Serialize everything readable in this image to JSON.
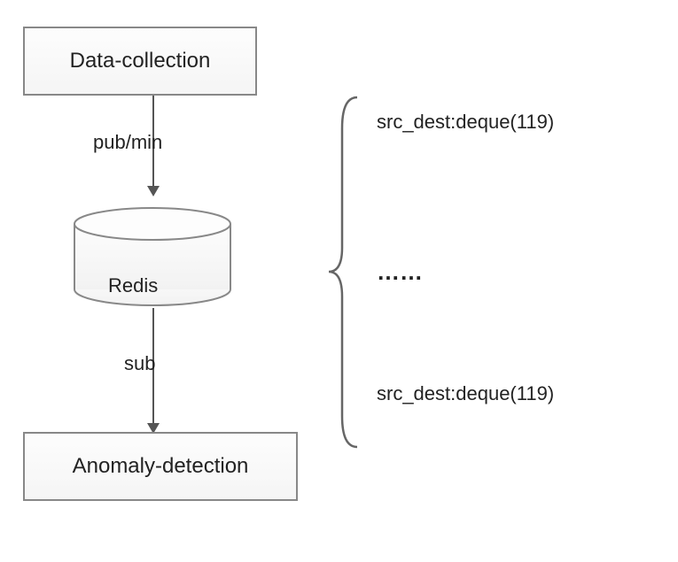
{
  "boxes": {
    "top": "Data-collection",
    "bottom": "Anomaly-detection"
  },
  "cylinder": {
    "label": "Redis"
  },
  "arrows": {
    "label1": "pub/min",
    "label2": "sub"
  },
  "brace": {
    "item1": "src_dest:deque(119)",
    "item2": "……",
    "item3": "src_dest:deque(119)"
  }
}
